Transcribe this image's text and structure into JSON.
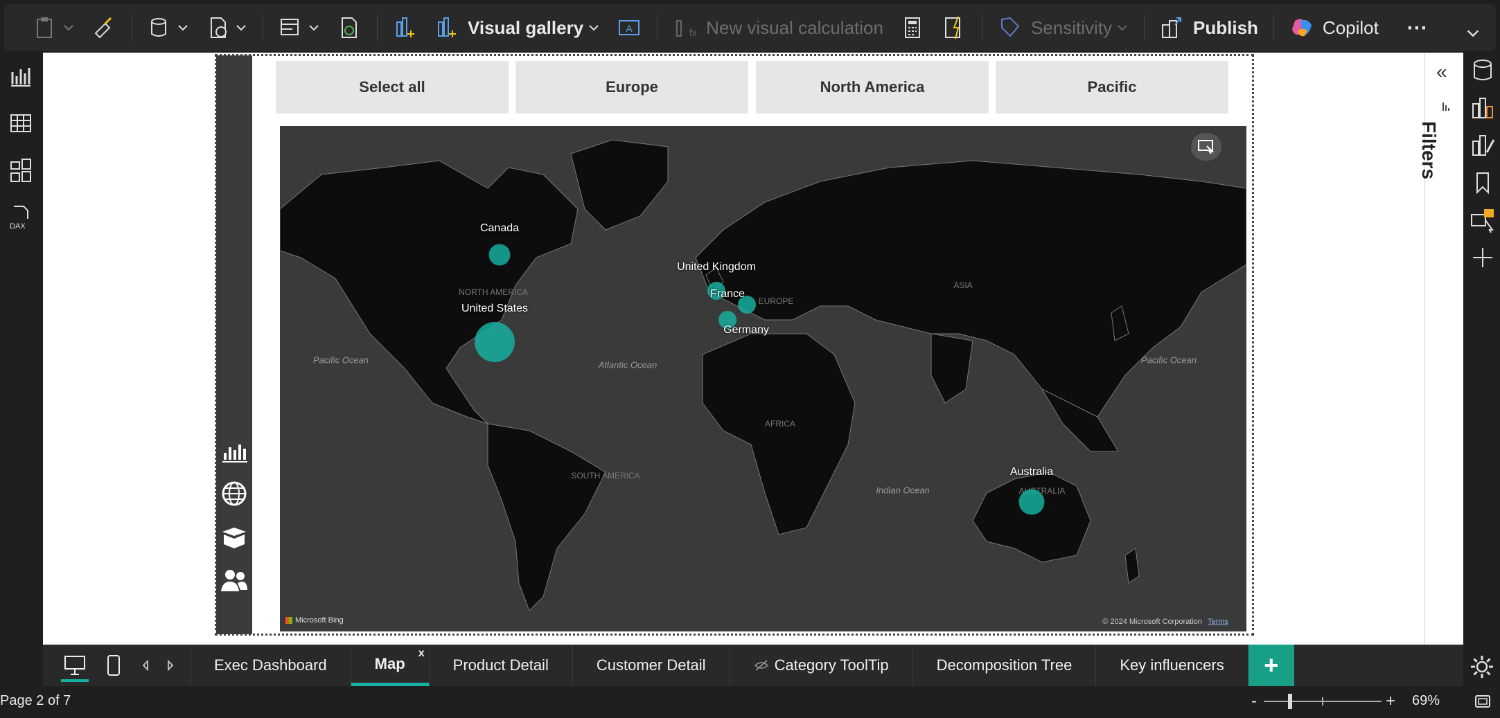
{
  "ribbon": {
    "visual_gallery": "Visual gallery",
    "new_visual_calc": "New visual calculation",
    "sensitivity": "Sensitivity",
    "publish": "Publish",
    "copilot": "Copilot",
    "more": "⋯"
  },
  "slicers": [
    "Select all",
    "Europe",
    "North America",
    "Pacific"
  ],
  "map": {
    "countries": [
      {
        "name": "Canada",
        "value": 1.4
      },
      {
        "name": "United States",
        "value": 5.0
      },
      {
        "name": "United Kingdom",
        "value": 1.0
      },
      {
        "name": "France",
        "value": 1.0
      },
      {
        "name": "Germany",
        "value": 1.0
      },
      {
        "name": "Australia",
        "value": 2.0
      }
    ],
    "oceans": [
      "Pacific Ocean",
      "Atlantic Ocean",
      "Indian Ocean",
      "Pacific Ocean"
    ],
    "regions": [
      "NORTH AMERICA",
      "EUROPE",
      "ASIA",
      "AFRICA",
      "SOUTH AMERICA",
      "AUSTRALIA"
    ],
    "bing": "Microsoft Bing",
    "copyright": "© 2024 Microsoft Corporation",
    "terms": "Terms",
    "bubble_color": "#17b2a4"
  },
  "filters": {
    "label": "Filters",
    "collapse": "«"
  },
  "tabs": [
    {
      "label": "Exec Dashboard"
    },
    {
      "label": "Map",
      "active": true,
      "close": "x"
    },
    {
      "label": "Product Detail"
    },
    {
      "label": "Customer Detail"
    },
    {
      "label": "Category ToolTip",
      "hidden": true
    },
    {
      "label": "Decomposition Tree"
    },
    {
      "label": "Key influencers"
    }
  ],
  "add_tab": "+",
  "status": {
    "page": "Page 2 of 7",
    "zoom": "69%",
    "minus": "-",
    "plus": "+"
  }
}
